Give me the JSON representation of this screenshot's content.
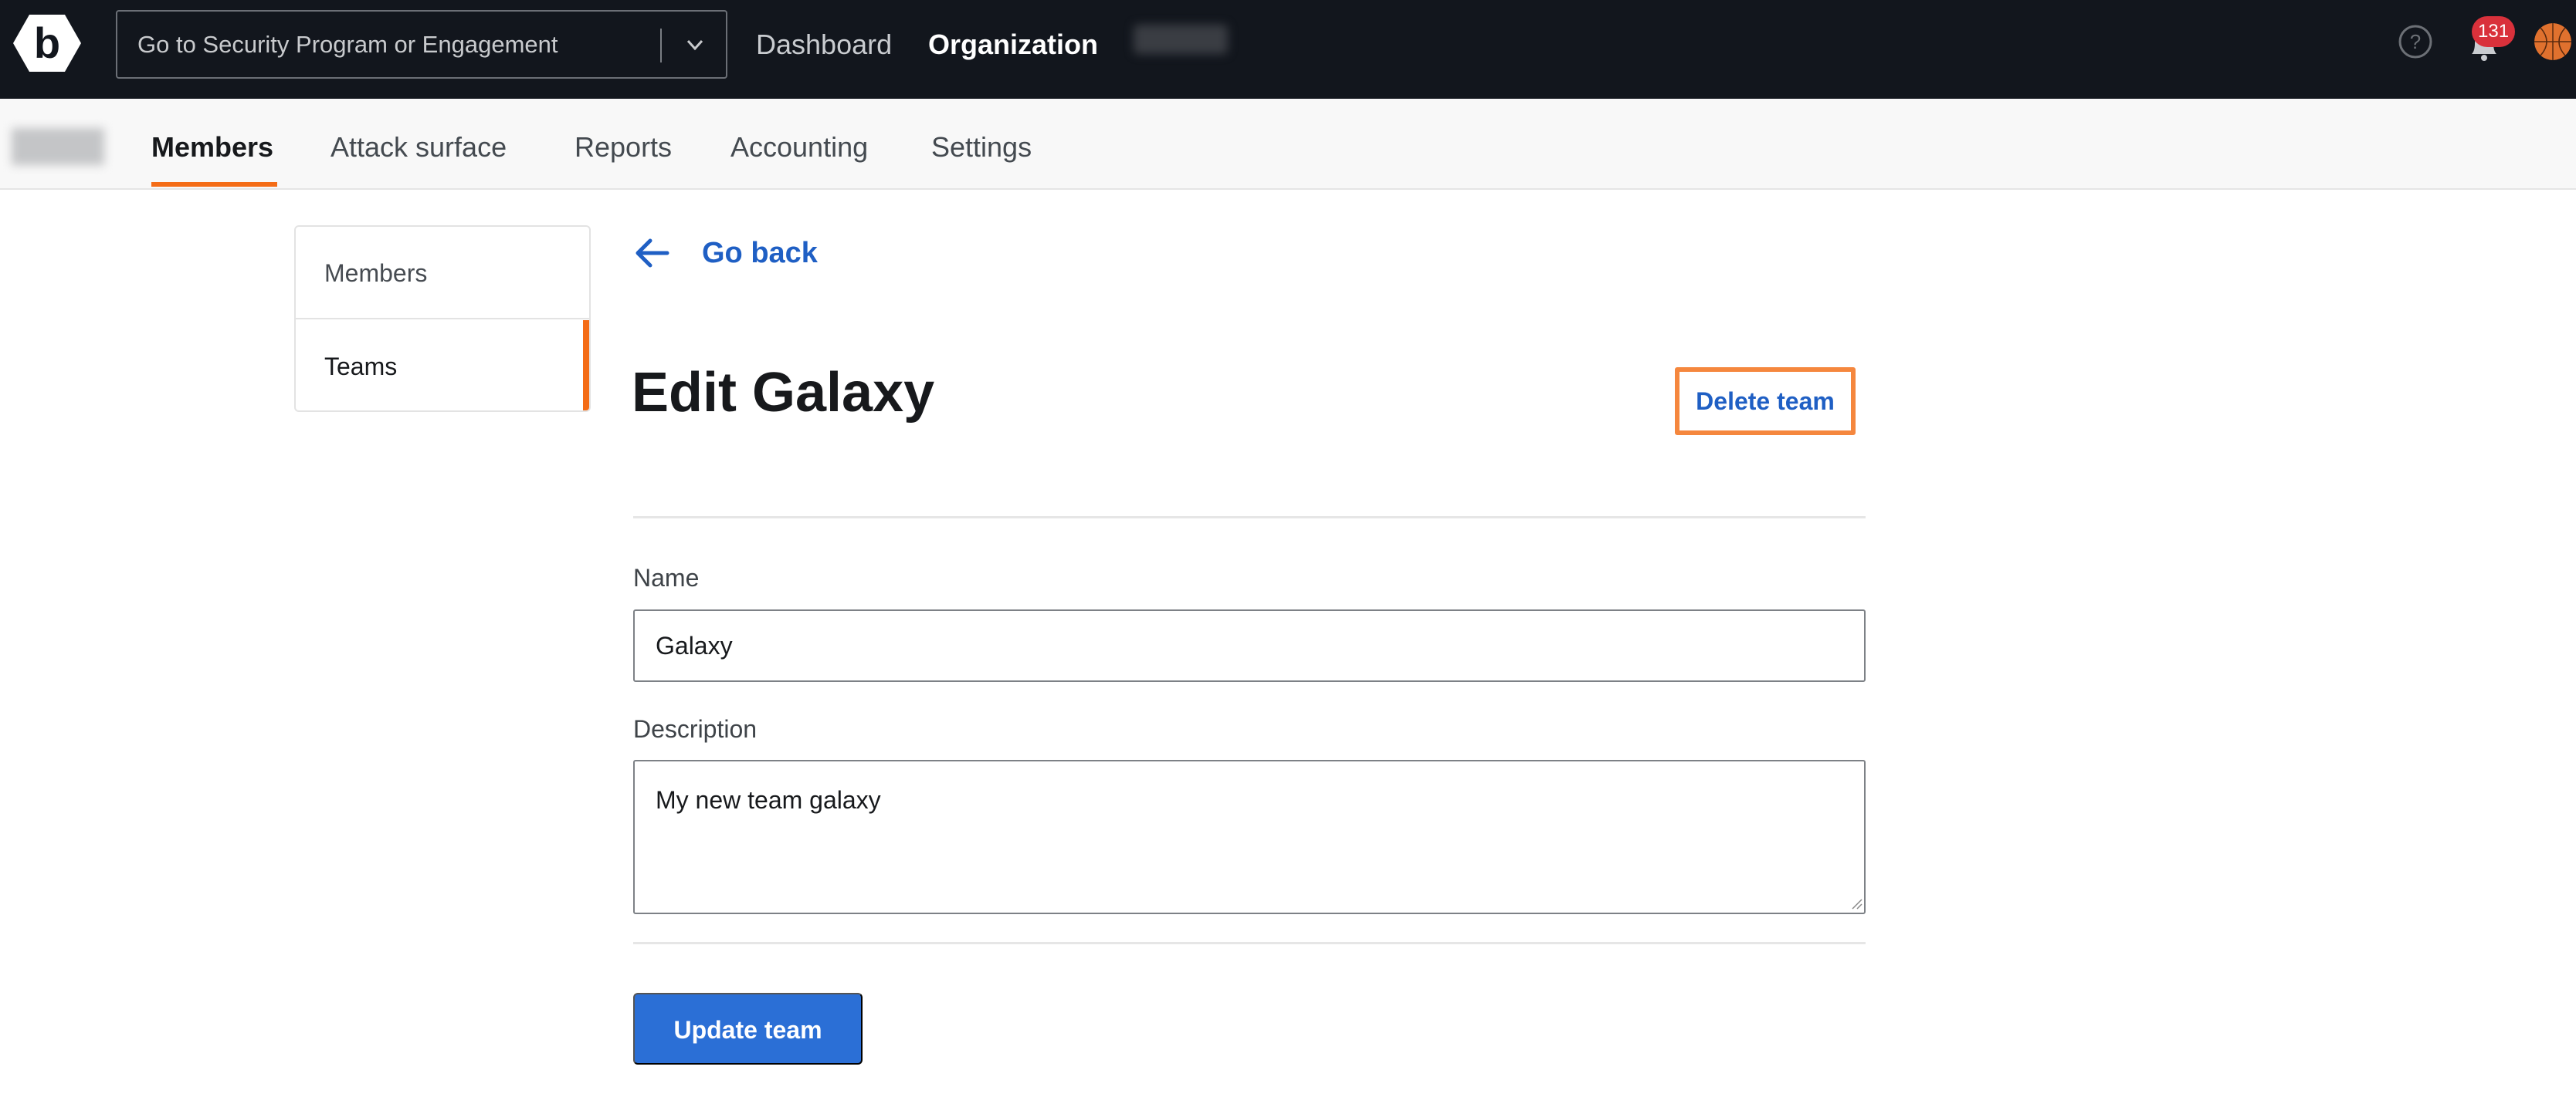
{
  "topbar": {
    "logo_icon": "bugcrowd-hexagon-b-logo",
    "switcher": {
      "placeholder": "Go to Security Program or Engagement",
      "icon": "chevron-down-icon"
    },
    "nav": [
      {
        "label": "Dashboard",
        "active": false
      },
      {
        "label": "Organization",
        "active": true
      }
    ],
    "org_name_redacted": true,
    "help_icon": "question-circle-icon",
    "notifications": {
      "icon": "bell-icon",
      "count": "131"
    },
    "avatar": "basketball-avatar"
  },
  "subnav": {
    "org_name_redacted": true,
    "tabs": [
      {
        "label": "Members",
        "active": true
      },
      {
        "label": "Attack surface",
        "active": false
      },
      {
        "label": "Reports",
        "active": false
      },
      {
        "label": "Accounting",
        "active": false
      },
      {
        "label": "Settings",
        "active": false
      }
    ],
    "accent_color": "#f46c16"
  },
  "sidebar": {
    "items": [
      {
        "label": "Members",
        "active": false
      },
      {
        "label": "Teams",
        "active": true
      }
    ]
  },
  "main": {
    "go_back_label": "Go back",
    "title": "Edit Galaxy",
    "delete_label": "Delete team",
    "form": {
      "name_label": "Name",
      "name_value": "Galaxy",
      "description_label": "Description",
      "description_value": "My new team galaxy"
    },
    "submit_label": "Update team",
    "link_color": "#1f5fc4",
    "primary_color": "#2b6fd6",
    "highlight_color": "#f5873e"
  }
}
